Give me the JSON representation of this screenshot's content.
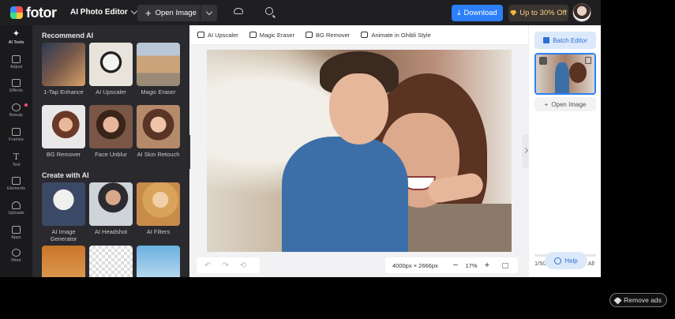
{
  "topbar": {
    "logo_text": "fotor",
    "app_menu_label": "AI Photo Editor",
    "open_image_label": "Open Image",
    "download_label": "Download",
    "promo_label": "Up to 30% Off"
  },
  "rail": {
    "items": [
      {
        "label": "AI Tools",
        "icon": "sparkle-icon"
      },
      {
        "label": "Adjust",
        "icon": "sliders-icon"
      },
      {
        "label": "Effects",
        "icon": "flask-icon"
      },
      {
        "label": "Beauty",
        "icon": "eye-icon"
      },
      {
        "label": "Frames",
        "icon": "frame-icon"
      },
      {
        "label": "Text",
        "icon": "text-icon"
      },
      {
        "label": "Elements",
        "icon": "shapes-icon"
      },
      {
        "label": "Uploads",
        "icon": "cloud-upload-icon"
      },
      {
        "label": "Apps",
        "icon": "apps-icon"
      },
      {
        "label": "More",
        "icon": "more-icon"
      }
    ]
  },
  "panel": {
    "recommend_heading": "Recommend AI",
    "create_heading": "Create with AI",
    "recommend_tiles": [
      "1-Tap Enhance",
      "AI Upscaler",
      "Magic Eraser",
      "BG Remover",
      "Face Unblur",
      "AI Skin Retouch"
    ],
    "create_tiles": [
      "AI Image Generator",
      "AI Headshot",
      "AI Filters"
    ]
  },
  "toolbar": {
    "items": [
      "AI Upscaler",
      "Magic Eraser",
      "BG Remover",
      "Animate in Ghibli Style"
    ]
  },
  "canvas": {
    "dimensions": "4000px × 2666px",
    "zoom": "17%"
  },
  "right": {
    "batch_label": "Batch Editor",
    "open_image_label": "Open Image",
    "count": "1/50",
    "clear_all_label": "Clear All",
    "help_label": "Help"
  },
  "remove_ads_label": "Remove ads",
  "colors": {
    "accent": "#2d7ff9",
    "topbar": "#1f1f22",
    "panel": "#2a2a2e"
  }
}
